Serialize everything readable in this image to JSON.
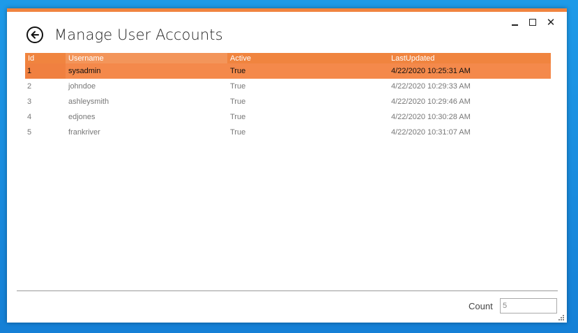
{
  "window": {
    "title": "Manage User Accounts",
    "accent_color": "#f0843f",
    "controls": {
      "minimize": "—",
      "maximize": "☐",
      "close": "✕"
    }
  },
  "grid": {
    "columns": [
      "Id",
      "Username",
      "Active",
      "LastUpdated"
    ],
    "rows": [
      {
        "id": "1",
        "username": "sysadmin",
        "active": "True",
        "last_updated": "4/22/2020 10:25:31 AM",
        "selected": true
      },
      {
        "id": "2",
        "username": "johndoe",
        "active": "True",
        "last_updated": "4/22/2020 10:29:33 AM",
        "selected": false
      },
      {
        "id": "3",
        "username": "ashleysmith",
        "active": "True",
        "last_updated": "4/22/2020 10:29:46 AM",
        "selected": false
      },
      {
        "id": "4",
        "username": "edjones",
        "active": "True",
        "last_updated": "4/22/2020 10:30:28 AM",
        "selected": false
      },
      {
        "id": "5",
        "username": "frankriver",
        "active": "True",
        "last_updated": "4/22/2020 10:31:07 AM",
        "selected": false
      }
    ]
  },
  "footer": {
    "count_label": "Count",
    "count_value": "5"
  }
}
